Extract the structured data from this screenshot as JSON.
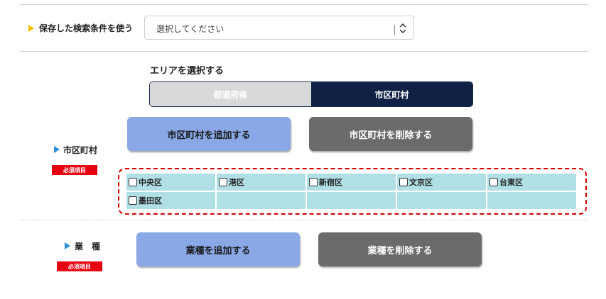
{
  "saved_search": {
    "label": "保存した検索条件を使う",
    "select_value": "選択してください"
  },
  "area": {
    "title": "エリアを選択する",
    "options": [
      "都道府県",
      "市区町村"
    ],
    "selected": "市区町村"
  },
  "municipality": {
    "label": "市区町村",
    "required": "必須項目",
    "add_button": "市区町村を追加する",
    "remove_button": "市区町村を削除する",
    "items": [
      {
        "name": "中央区",
        "checked": false
      },
      {
        "name": "港区",
        "checked": false
      },
      {
        "name": "新宿区",
        "checked": false
      },
      {
        "name": "文京区",
        "checked": false
      },
      {
        "name": "台東区",
        "checked": false
      },
      {
        "name": "墨田区",
        "checked": false
      }
    ]
  },
  "industry": {
    "label": "業　種",
    "required": "必須項目",
    "add_button": "業種を追加する",
    "remove_button": "業種を削除する"
  },
  "colors": {
    "accent_yellow": "#f2c200",
    "accent_blue": "#2f8fd8",
    "navy": "#0f2245",
    "required_red": "#e60012",
    "cell_bg": "#b0dfe5"
  }
}
